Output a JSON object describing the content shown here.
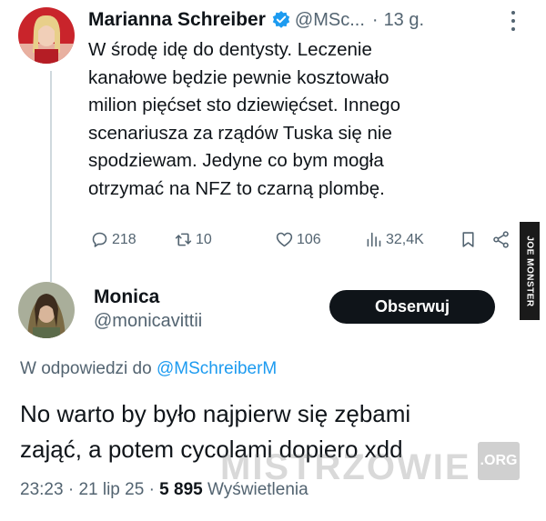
{
  "tweet": {
    "author_name": "Marianna Schreiber",
    "handle": "@MSc...",
    "separator": "·",
    "time": "13 g.",
    "text": "W środę idę do dentysty. Leczenie\nkanałowe będzie pewnie kosztowało\nmilion pięćset sto dziewięćset. Innego\nscenariusza za rządów Tuska się nie\nspodziewam. Jedyne co bym mogła\notrzymać na NFZ to czarną plombę.",
    "stats": {
      "replies": "218",
      "retweets": "10",
      "likes": "106",
      "views": "32,4K"
    }
  },
  "reply": {
    "author_name": "Monica",
    "handle": "@monicavittii",
    "follow_label": "Obserwuj",
    "reply_prefix": "W odpowiedzi do",
    "reply_mention": "@MSchreiberM",
    "text": "No warto by było najpierw się zębami\nzająć, a potem cycolami dopiero xdd",
    "time": "23:23",
    "date": "21 lip 25",
    "dot": "·",
    "views_count": "5 895",
    "views_label": "Wyświetlenia"
  },
  "watermarks": {
    "side_tag": "JOE MONSTER",
    "site": "MISTRZOWIE",
    "site_tld": ".ORG"
  },
  "colors": {
    "text": "#0f1419",
    "secondary": "#536471",
    "accent": "#1d9bf0",
    "follow_button": "#0f1419"
  },
  "icons": [
    "verified-badge-icon",
    "more-options-icon",
    "reply-icon",
    "retweet-icon",
    "like-icon",
    "views-icon",
    "bookmark-icon",
    "share-icon"
  ]
}
